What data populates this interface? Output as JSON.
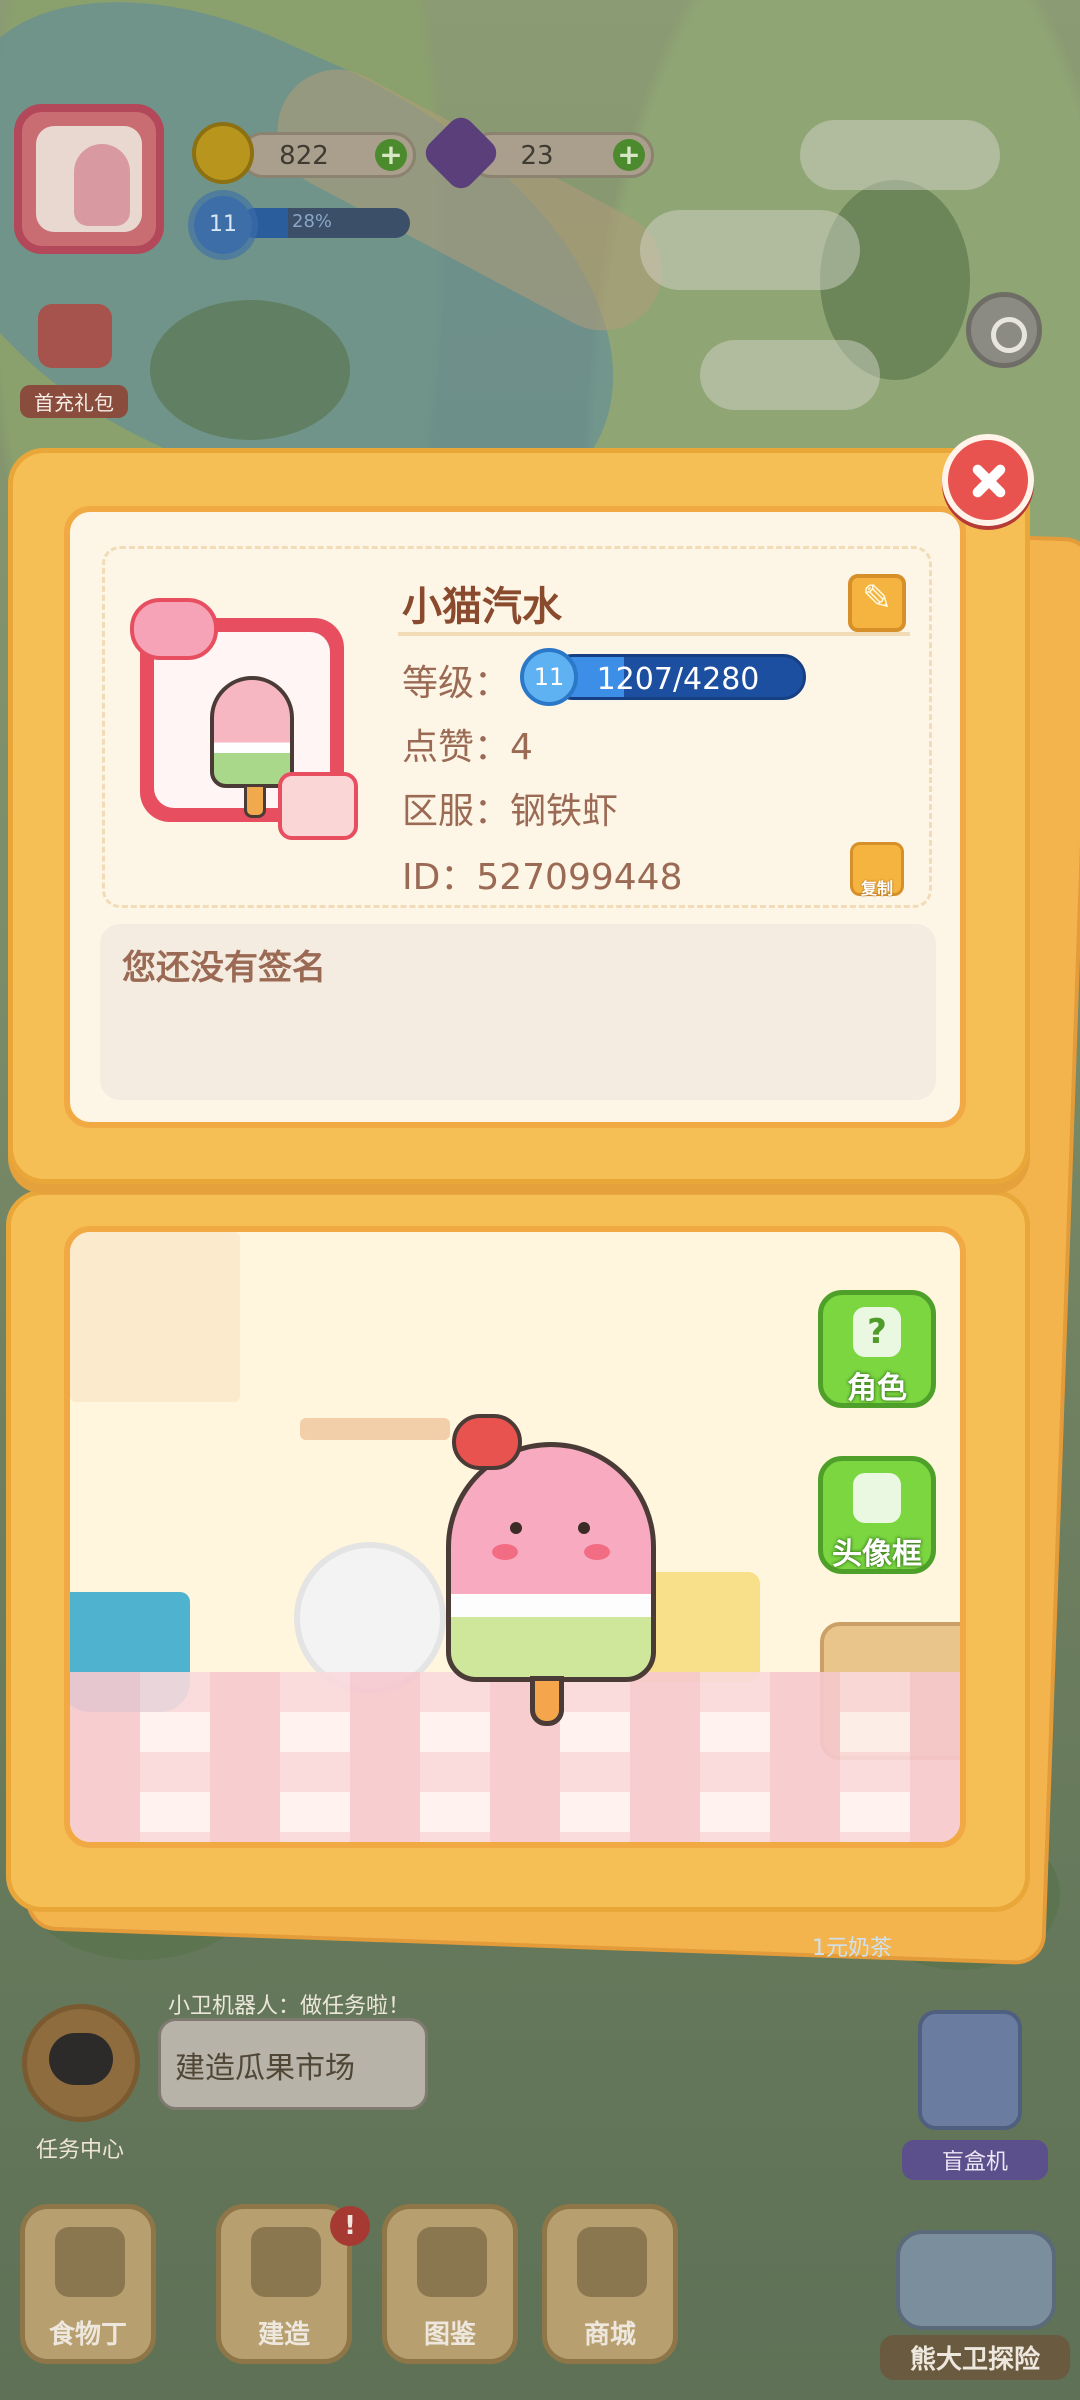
{
  "hud": {
    "coins": "822",
    "gems": "23",
    "level": "11",
    "level_progress": "28%",
    "level_progress_fraction": 0.28,
    "first_recharge_gift": "首充礼包"
  },
  "profile": {
    "name": "小猫汽水",
    "level_label": "等级：",
    "level": "11",
    "exp_text": "1207/4280",
    "exp_fraction": 0.282,
    "likes_label": "点赞：",
    "likes": "4",
    "server_label": "区服：",
    "server": "钢铁虾",
    "id_label": "ID：",
    "id": "527099448",
    "copy_label": "复制",
    "signature_placeholder": "您还没有签名"
  },
  "side_buttons": {
    "character": "角色",
    "avatar_frame": "头像框"
  },
  "bottom_hud": {
    "robot_tip": "小卫机器人：做任务啦！",
    "task_bubble": "建造瓜果市场",
    "task_center": "任务中心",
    "milk_tea": "1元奶茶",
    "blind_box": "盲盒机",
    "nav": {
      "food": "食物丁",
      "build": "建造",
      "codex": "图鉴",
      "shop": "商城",
      "explore": "熊大卫探险"
    },
    "build_badge": "!"
  },
  "icons": {
    "close": "close-icon",
    "edit": "edit-icon",
    "copy": "copy-icon",
    "settings": "gear-icon",
    "coin": "coin-icon",
    "gem": "gem-icon"
  },
  "colors": {
    "panel": "#f6bf55",
    "card_bg": "#fdf6e6",
    "text_brown": "#9b6a55",
    "close_red": "#e8534f",
    "level_blue": "#1d4fa0",
    "green_button": "#7bd640"
  }
}
